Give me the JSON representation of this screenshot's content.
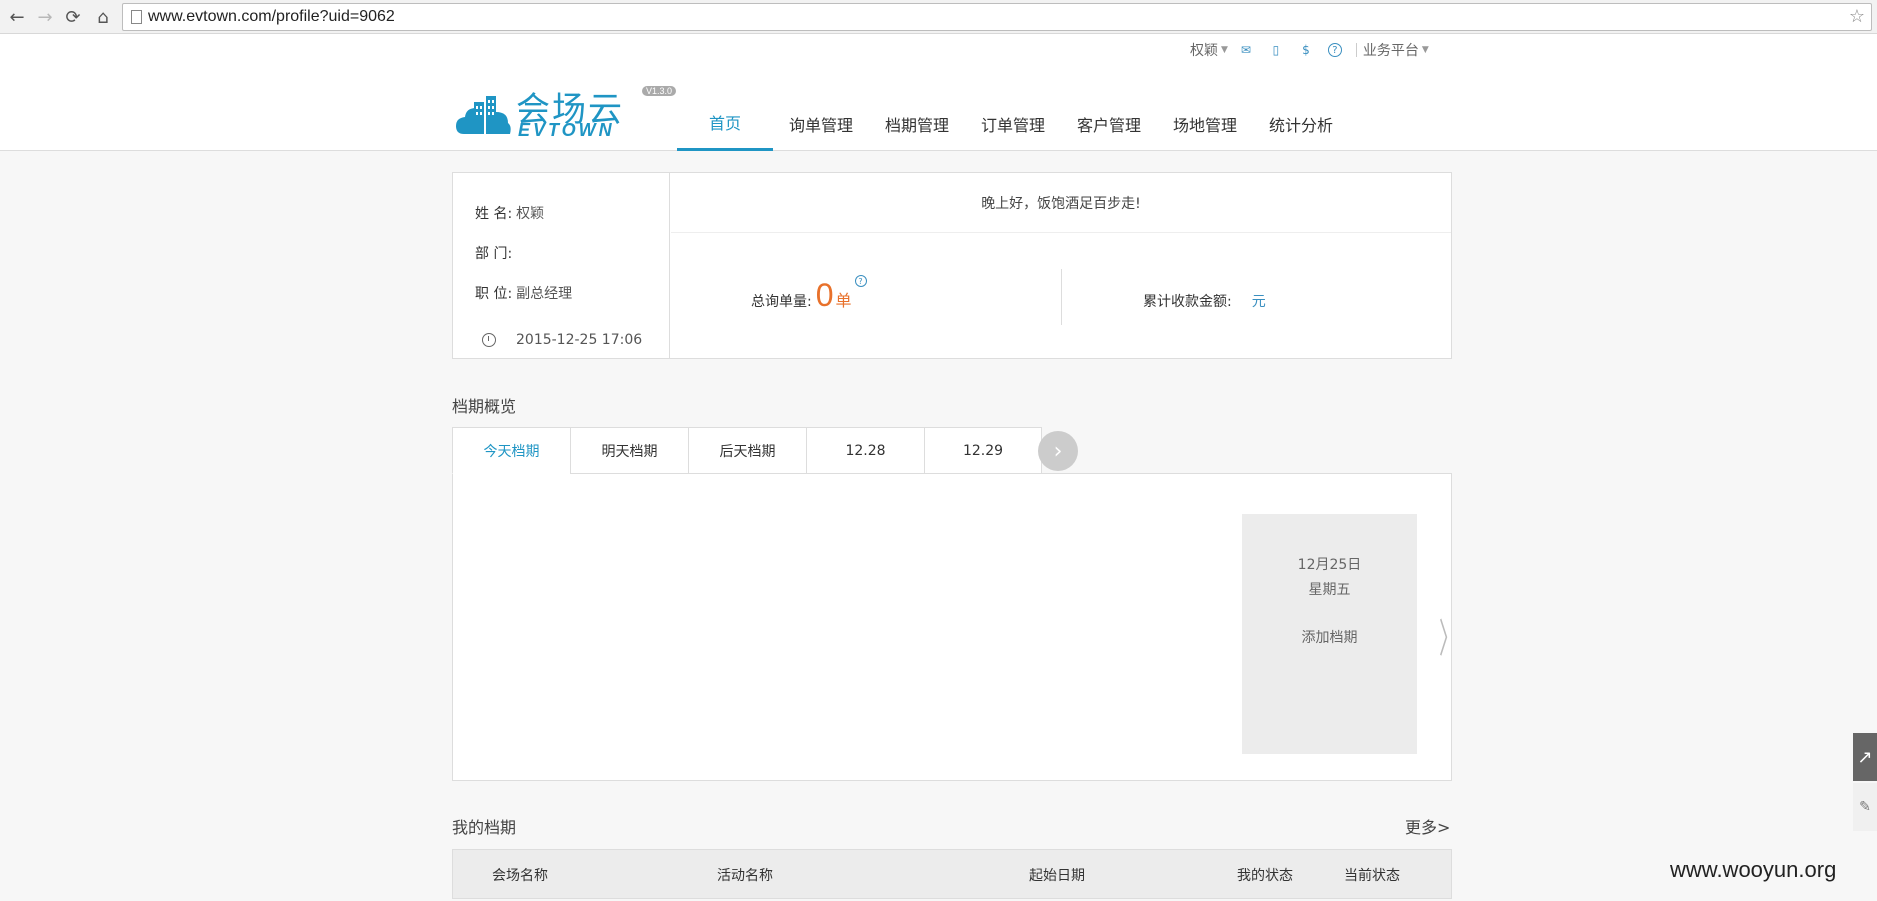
{
  "browser": {
    "url": "www.evtown.com/profile?uid=9062"
  },
  "userbar": {
    "username": "权颖",
    "platform": "业务平台"
  },
  "logo": {
    "cn": "会场云",
    "en": "EVTOWN",
    "version": "V1.3.0"
  },
  "nav": {
    "items": [
      "首页",
      "询单管理",
      "档期管理",
      "订单管理",
      "客户管理",
      "场地管理",
      "统计分析"
    ],
    "active": "首页"
  },
  "profile": {
    "name_label": "姓 名:",
    "name_value": "权颖",
    "dept_label": "部 门:",
    "dept_value": "",
    "title_label": "职 位:",
    "title_value": "副总经理",
    "datetime": "2015-12-25 17:06",
    "greeting": "晚上好，饭饱酒足百步走!",
    "inquiry_label": "总询单量:",
    "inquiry_count": "0",
    "inquiry_unit": "单",
    "amount_label": "累计收款金额:",
    "amount_unit": "元"
  },
  "schedule": {
    "section_title": "档期概览",
    "tabs": [
      "今天档期",
      "明天档期",
      "后天档期",
      "12.28",
      "12.29"
    ],
    "active_tab": "今天档期",
    "card": {
      "date": "12月25日",
      "weekday": "星期五",
      "action": "添加档期"
    }
  },
  "my_schedule": {
    "title": "我的档期",
    "more": "更多>",
    "columns": [
      "会场名称",
      "活动名称",
      "起始日期",
      "我的状态",
      "当前状态"
    ]
  },
  "watermark": "www.wooyun.org",
  "colors": {
    "accent": "#1f95c4",
    "number": "#e8712b"
  }
}
